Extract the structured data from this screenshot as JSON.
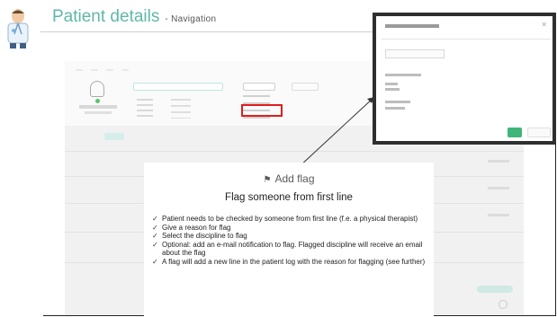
{
  "slide": {
    "title": "Patient details",
    "subtitle": "- Navigation"
  },
  "card": {
    "heading": "Add flag",
    "subheading": "Flag someone from first line",
    "items": [
      "Patient needs to be checked by someone from first line (f.e. a physical therapist)",
      "Give a reason for flag",
      "Select the discipline to flag",
      "Optional: add an e-mail notification to flag. Flagged discipline will receive an email about the flag",
      "A flag will add a new line in the patient log with the reason for flagging (see further)"
    ]
  },
  "colors": {
    "title": "#5fb7a9",
    "highlight": "#e11d1d",
    "confirm": "#3fb57a",
    "status_online": "#5cc36b"
  },
  "icons": {
    "mascot": "doctor-icon",
    "flag": "flag-icon",
    "check": "checkmark-icon",
    "close": "close-icon"
  }
}
